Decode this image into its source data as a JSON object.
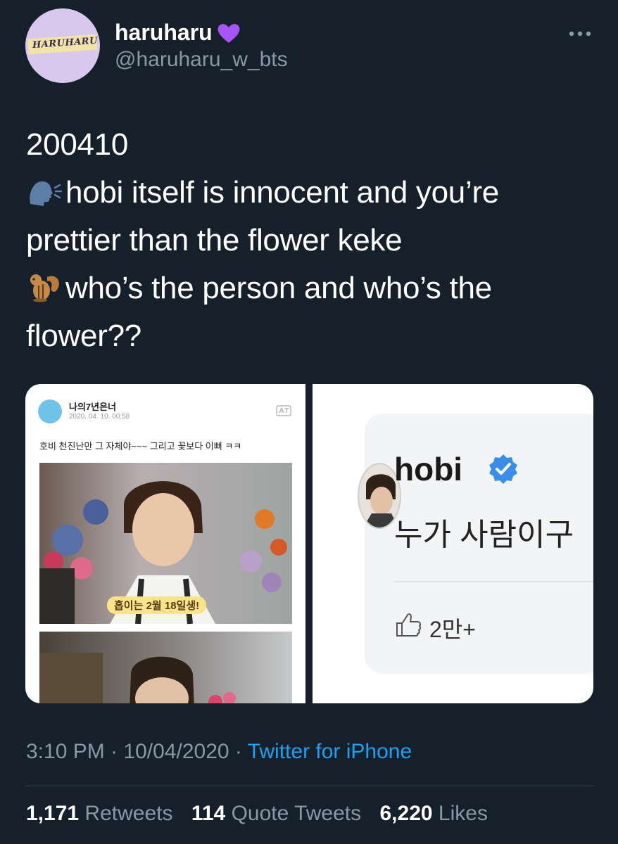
{
  "user": {
    "display_name": "haruharu",
    "handle": "@haruharu_w_bts",
    "avatar_logo_text": "HARUHARU"
  },
  "tweet": {
    "lines": [
      "200410",
      "hobi itself is innocent and you’re",
      "prettier than the flower keke",
      "who’s the person and who’s the",
      "flower??"
    ],
    "emoji_names": [
      "speaking-head-emoji",
      "chipmunk-emoji"
    ]
  },
  "media_left": {
    "account_name": "나의7년은너",
    "post_date": "2020. 04. 10. 00:58",
    "post_text": "호비 천진난만 그 자체야~~~  그리고 꽃보다 이뻐 ㅋㅋ",
    "caption_sticker": "홉이는 2월 18일생!"
  },
  "media_right": {
    "comment_author": "hobi",
    "comment_text": "누가 사람이구",
    "like_count": "2만+"
  },
  "meta": {
    "time": "3:10 PM",
    "date": "10/04/2020",
    "separator": "·",
    "source": "Twitter for iPhone"
  },
  "stats": {
    "retweets_count": "1,171",
    "retweets_label": "Retweets",
    "quote_count": "114",
    "quote_label": "Quote Tweets",
    "likes_count": "6,220",
    "likes_label": "Likes"
  },
  "colors": {
    "background": "#15202b",
    "secondary_text": "#8899a6",
    "link": "#1da1f2",
    "heart": "#a855f7",
    "verified": "#3b8ee8"
  }
}
